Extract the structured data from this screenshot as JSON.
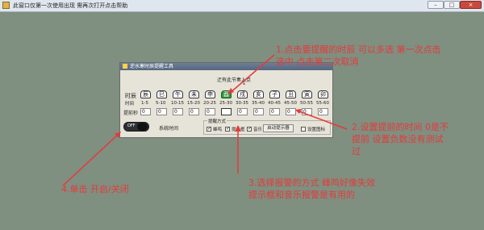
{
  "window": {
    "title": "此窗口仅第一次使用出现 需再次打开点击帮助",
    "controls": {
      "minimize": "–",
      "maximize": "□",
      "close": "×"
    }
  },
  "dialog": {
    "title": "逆水寒时辰提醒工具",
    "hint": "迂有此节奏入京",
    "hint_arrow": "↓",
    "row_labels": {
      "shichen": "时辰",
      "time": "时间",
      "advance": "提前秒"
    },
    "hours": [
      {
        "name": "辰",
        "range": "1-5",
        "advance": "0",
        "selected": false
      },
      {
        "name": "巳",
        "range": "5-10",
        "advance": "0",
        "selected": false
      },
      {
        "name": "午",
        "range": "10-15",
        "advance": "0",
        "selected": false
      },
      {
        "name": "未",
        "range": "15-20",
        "advance": "0",
        "selected": false
      },
      {
        "name": "申",
        "range": "20-25",
        "advance": "0",
        "selected": false
      },
      {
        "name": "酉",
        "range": "25-30",
        "advance": "",
        "selected": true
      },
      {
        "name": "戌",
        "range": "30-35",
        "advance": "0",
        "selected": false
      },
      {
        "name": "亥",
        "range": "35-40",
        "advance": "0",
        "selected": false
      },
      {
        "name": "子",
        "range": "40-45",
        "advance": "0",
        "selected": false
      },
      {
        "name": "丑",
        "range": "45-50",
        "advance": "0",
        "selected": false
      },
      {
        "name": "寅",
        "range": "50-55",
        "advance": "0",
        "selected": false
      },
      {
        "name": "卯",
        "range": "55-60",
        "advance": "0",
        "selected": false
      }
    ],
    "toggle": {
      "text": "OFF",
      "label": "系统时间",
      "state": "off"
    },
    "reminder": {
      "title": "提醒方式",
      "options": [
        {
          "label": "蜂鸣",
          "checked": true
        },
        {
          "label": "提示框",
          "checked": true
        },
        {
          "label": "音乐",
          "checked": true
        }
      ],
      "button": "启动提示器",
      "icon_option": {
        "label": "设置图标",
        "checked": false
      }
    }
  },
  "annotations": {
    "note1_line1": "1.点击要提醒的时辰 可以多选 第一次点击",
    "note1_line2": "选中 点击第二次取消",
    "note2_line1": "2.设置提前的时间 0是不",
    "note2_line2": "提前 设置负数没有测试",
    "note2_line3": "过",
    "note3_line1": "3.选择报警的方式 峰鸣好像失效",
    "note3_line2": "提示框和音乐报警是有用的",
    "note4": "4.单击 开启/关闭",
    "color": "#e53a3a"
  },
  "colors": {
    "background": "#7f8f80",
    "dialog": "#e6e3d8",
    "selected_hour": "#2e9b3a"
  }
}
